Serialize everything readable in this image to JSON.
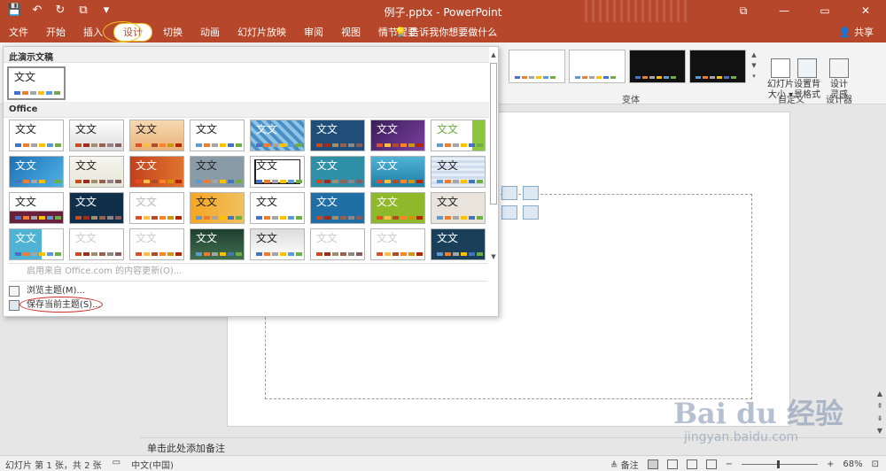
{
  "titlebar": {
    "title": "例子.pptx  -  PowerPoint",
    "qat": [
      "💾",
      "↶",
      "↻",
      "⧉",
      "▾"
    ],
    "window_buttons": [
      "—",
      "⧉",
      "▭",
      "✕"
    ]
  },
  "tabs": [
    {
      "label": "文件"
    },
    {
      "label": "开始"
    },
    {
      "label": "插入"
    },
    {
      "label": "设计",
      "active": true
    },
    {
      "label": "切换"
    },
    {
      "label": "动画"
    },
    {
      "label": "幻灯片放映"
    },
    {
      "label": "审阅"
    },
    {
      "label": "视图"
    },
    {
      "label": "情节提要"
    }
  ],
  "tellme": "告诉我你想要做什么",
  "share": "共享",
  "ribbon": {
    "variants_label": "变体",
    "custom_label": "自定义",
    "designer_label": "设计器",
    "slide_size": "幻灯片\n大小 ▾",
    "format_bg": "设置背\n景格式",
    "design_ideas": "设计\n灵感"
  },
  "dropdown": {
    "section_current": "此演示文稿",
    "section_office": "Office",
    "theme_text": "文文",
    "enable_updates": "启用来自 Office.com 的内容更新(O)...",
    "browse": "浏览主题(M)...",
    "save_theme": "保存当前主题(S)...",
    "scroll_up": "▲",
    "scroll_down": "▼"
  },
  "notes": "单击此处添加备注",
  "status": {
    "slide": "幻灯片 第 1 张，共 2 张",
    "lang": "中文(中国)",
    "notes": "备注",
    "zoom": "68%",
    "zoom_fraction": 0.48,
    "minus": "−",
    "plus": "+"
  },
  "watermark": {
    "brand": "Bai du 经验",
    "url": "jingyan.baidu.com"
  },
  "colors": {
    "accent": "#b7472a",
    "tab_highlight": "#f0c020",
    "annotation": "#d02a2a"
  }
}
